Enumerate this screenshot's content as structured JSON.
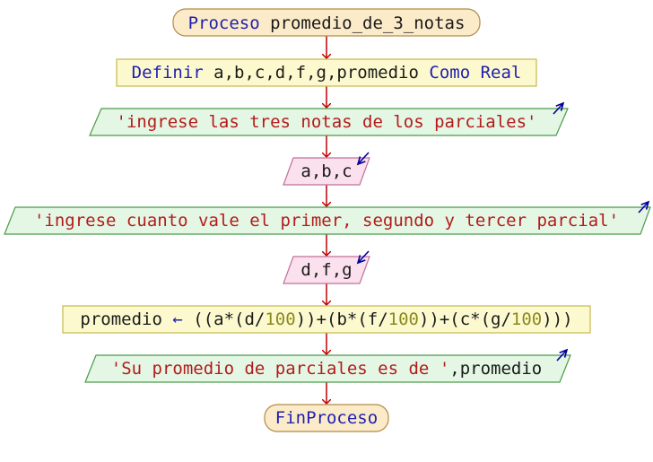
{
  "colors": {
    "keyword": "#1f1fb0",
    "text": "#1a1a1a",
    "string": "#b31b1b",
    "number": "#8a8a1a",
    "arrow": "#c00000",
    "io_arrow": "#000099",
    "process_fill": "#fbebc8",
    "process_stroke": "#b38a4a",
    "def_fill": "#fdf9cf",
    "def_stroke": "#c6b94a",
    "output_fill": "#e4f6e4",
    "output_stroke": "#4a9a4a",
    "input_fill": "#fbe0ee",
    "input_stroke": "#c0709a"
  },
  "nodes": {
    "start": {
      "kw": "Proceso",
      "name": "promedio_de_3_notas"
    },
    "define": {
      "kw1": "Definir",
      "vars": "a,b,c,d,f,g,promedio",
      "kw2": "Como",
      "kw3": "Real"
    },
    "out1": {
      "text": "'ingrese las tres notas de los parciales'"
    },
    "in1": {
      "text": "a,b,c"
    },
    "out2": {
      "text": "'ingrese cuanto vale el primer, segundo y tercer parcial'"
    },
    "in2": {
      "text": "d,f,g"
    },
    "assign": {
      "lhs": "promedio",
      "arrow": "←",
      "p1": "((a*(d/",
      "n1": "100",
      "p2": "))+(b*(f/",
      "n2": "100",
      "p3": "))+(c*(g/",
      "n3": "100",
      "p4": ")))"
    },
    "out3": {
      "str": "'Su promedio de parciales es de '",
      "rest": ",promedio"
    },
    "end": {
      "kw": "FinProceso"
    }
  }
}
